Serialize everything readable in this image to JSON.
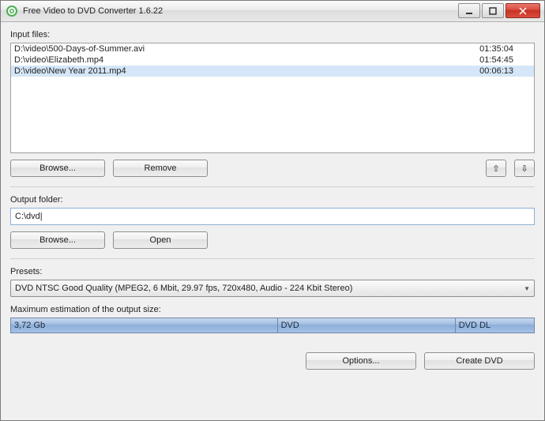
{
  "titlebar": {
    "title": "Free Video to DVD Converter 1.6.22"
  },
  "labels": {
    "input_files": "Input files:",
    "output_folder": "Output folder:",
    "presets": "Presets:",
    "max_estimation": "Maximum estimation of the output size:"
  },
  "files": [
    {
      "path": "D:\\video\\500-Days-of-Summer.avi",
      "duration": "01:35:04"
    },
    {
      "path": "D:\\video\\Elizabeth.mp4",
      "duration": "01:54:45"
    },
    {
      "path": "D:\\video\\New Year 2011.mp4",
      "duration": "00:06:13"
    }
  ],
  "buttons": {
    "browse": "Browse...",
    "remove": "Remove",
    "open": "Open",
    "options": "Options...",
    "create_dvd": "Create DVD",
    "up_icon": "⇧",
    "down_icon": "⇩"
  },
  "output_folder": {
    "value": "C:\\dvd|"
  },
  "preset": {
    "selected": "DVD NTSC Good Quality (MPEG2, 6 Mbit, 29.97 fps, 720x480, Audio - 224 Kbit Stereo)"
  },
  "estimation": {
    "size": "3,72 Gb",
    "dvd": "DVD",
    "dvd_dl": "DVD DL"
  }
}
